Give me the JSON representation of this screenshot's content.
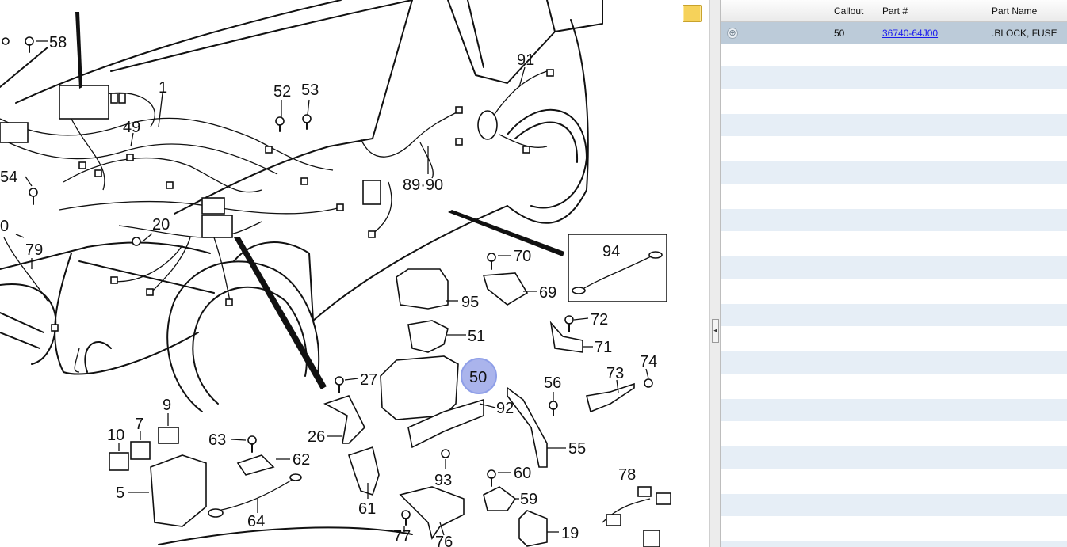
{
  "diagram": {
    "callouts": [
      {
        "id": "58",
        "label": "58"
      },
      {
        "id": "1",
        "label": "1"
      },
      {
        "id": "52",
        "label": "52"
      },
      {
        "id": "53",
        "label": "53"
      },
      {
        "id": "49",
        "label": "49"
      },
      {
        "id": "54",
        "label": "54"
      },
      {
        "id": "0",
        "label": "0"
      },
      {
        "id": "20",
        "label": "20"
      },
      {
        "id": "79",
        "label": "79"
      },
      {
        "id": "91",
        "label": "91"
      },
      {
        "id": "89-90",
        "label": "89·90"
      },
      {
        "id": "94",
        "label": "94"
      },
      {
        "id": "70",
        "label": "70"
      },
      {
        "id": "69",
        "label": "69"
      },
      {
        "id": "95",
        "label": "95"
      },
      {
        "id": "51",
        "label": "51"
      },
      {
        "id": "72",
        "label": "72"
      },
      {
        "id": "71",
        "label": "71"
      },
      {
        "id": "50",
        "label": "50"
      },
      {
        "id": "27",
        "label": "27"
      },
      {
        "id": "74",
        "label": "74"
      },
      {
        "id": "73",
        "label": "73"
      },
      {
        "id": "56",
        "label": "56"
      },
      {
        "id": "92",
        "label": "92"
      },
      {
        "id": "9",
        "label": "9"
      },
      {
        "id": "7",
        "label": "7"
      },
      {
        "id": "10",
        "label": "10"
      },
      {
        "id": "63",
        "label": "63"
      },
      {
        "id": "26",
        "label": "26"
      },
      {
        "id": "62",
        "label": "62"
      },
      {
        "id": "55",
        "label": "55"
      },
      {
        "id": "5",
        "label": "5"
      },
      {
        "id": "93",
        "label": "93"
      },
      {
        "id": "60",
        "label": "60"
      },
      {
        "id": "78",
        "label": "78"
      },
      {
        "id": "61",
        "label": "61"
      },
      {
        "id": "59",
        "label": "59"
      },
      {
        "id": "64",
        "label": "64"
      },
      {
        "id": "77",
        "label": "77"
      },
      {
        "id": "76",
        "label": "76"
      },
      {
        "id": "19",
        "label": "19"
      }
    ],
    "highlighted_callout": "50",
    "highlight_color": "#8f9fe8"
  },
  "note_icon": "note-icon",
  "collapse_icon": "◂",
  "parts_table": {
    "columns": {
      "callout": "Callout",
      "part_number": "Part #",
      "part_name": "Part Name"
    },
    "rows": [
      {
        "expand_icon": "⊕",
        "callout": "50",
        "part_number": "36740-64J00",
        "part_name": ".BLOCK, FUSE"
      }
    ],
    "selected_row_color": "#bccbd9",
    "stripe_color": "#e6eef6"
  }
}
